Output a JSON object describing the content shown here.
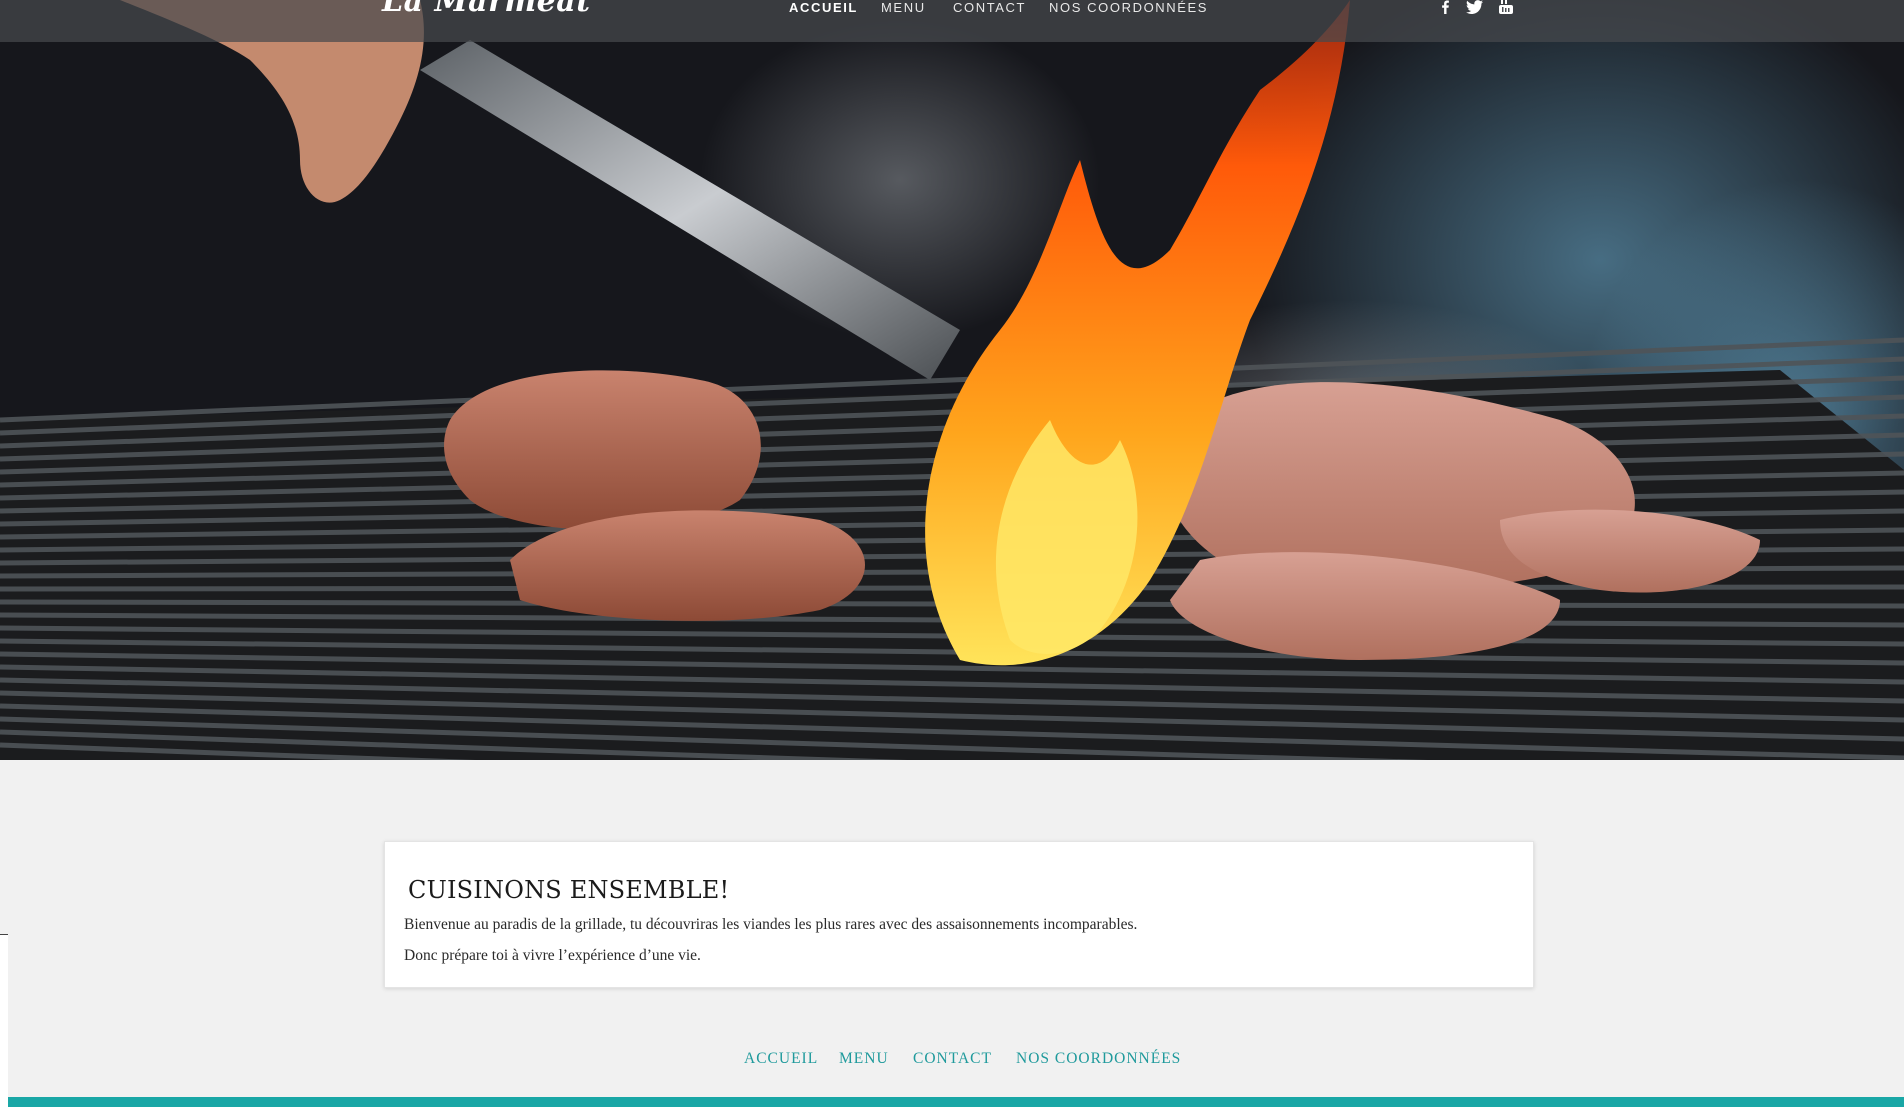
{
  "colors": {
    "accent": "#1aa7a6",
    "footer_link": "#1f9a9c",
    "page_bg": "#f1f1f1",
    "navbar_bg": "rgba(70,74,78,0.72)"
  },
  "brand": {
    "name": "La Marmeat"
  },
  "nav": {
    "items": [
      {
        "label": "ACCUEIL",
        "active": true
      },
      {
        "label": "MENU",
        "active": false
      },
      {
        "label": "CONTACT",
        "active": false
      },
      {
        "label": "NOS COORDONNÉES",
        "active": false
      }
    ],
    "social": [
      {
        "icon": "facebook-icon"
      },
      {
        "icon": "twitter-icon"
      },
      {
        "icon": "youtube-icon"
      }
    ]
  },
  "hero": {
    "image": "grill-with-flames-and-meat-photo"
  },
  "card": {
    "title": "CUISINONS ENSEMBLE!",
    "paragraphs": [
      "Bienvenue au paradis de la grillade, tu découvriras les viandes les plus rares avec des assaisonnements incomparables.",
      "Donc prépare toi à vivre l’expérience d’une vie."
    ]
  },
  "footer": {
    "links": [
      {
        "label": "ACCUEIL"
      },
      {
        "label": "MENU"
      },
      {
        "label": "CONTACT"
      },
      {
        "label": "NOS COORDONNÉES"
      }
    ]
  }
}
